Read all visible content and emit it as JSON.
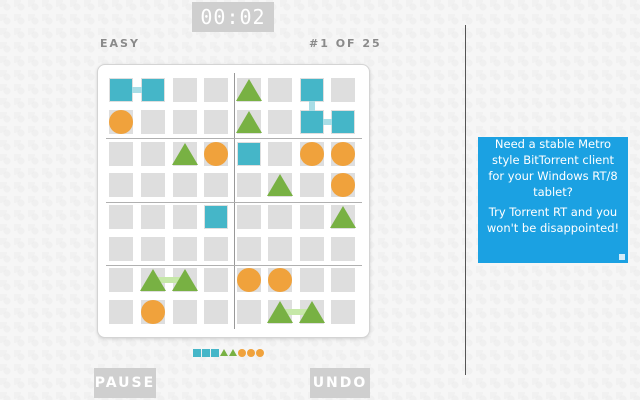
{
  "timer": "00:02",
  "difficulty": "EASY",
  "progress": "#1 OF 25",
  "colors": {
    "square": "#45b6c8",
    "circle": "#f0a23c",
    "triangle": "#78b143",
    "cell": "#dedede"
  },
  "board": {
    "size": 8,
    "pieces": [
      {
        "r": 0,
        "c": 0,
        "t": "square"
      },
      {
        "r": 0,
        "c": 1,
        "t": "square"
      },
      {
        "r": 0,
        "c": 4,
        "t": "triangle"
      },
      {
        "r": 0,
        "c": 6,
        "t": "square"
      },
      {
        "r": 1,
        "c": 0,
        "t": "circle"
      },
      {
        "r": 1,
        "c": 4,
        "t": "triangle"
      },
      {
        "r": 1,
        "c": 6,
        "t": "square"
      },
      {
        "r": 1,
        "c": 7,
        "t": "square"
      },
      {
        "r": 2,
        "c": 2,
        "t": "triangle"
      },
      {
        "r": 2,
        "c": 3,
        "t": "circle"
      },
      {
        "r": 2,
        "c": 4,
        "t": "square"
      },
      {
        "r": 2,
        "c": 6,
        "t": "circle"
      },
      {
        "r": 2,
        "c": 7,
        "t": "circle"
      },
      {
        "r": 3,
        "c": 5,
        "t": "triangle"
      },
      {
        "r": 3,
        "c": 7,
        "t": "circle"
      },
      {
        "r": 4,
        "c": 3,
        "t": "square"
      },
      {
        "r": 4,
        "c": 7,
        "t": "triangle"
      },
      {
        "r": 6,
        "c": 1,
        "t": "triangle"
      },
      {
        "r": 6,
        "c": 2,
        "t": "triangle"
      },
      {
        "r": 6,
        "c": 4,
        "t": "circle"
      },
      {
        "r": 6,
        "c": 5,
        "t": "circle"
      },
      {
        "r": 7,
        "c": 1,
        "t": "circle"
      },
      {
        "r": 7,
        "c": 5,
        "t": "triangle"
      },
      {
        "r": 7,
        "c": 6,
        "t": "triangle"
      }
    ],
    "connections": [
      {
        "from": [
          0,
          0
        ],
        "to": [
          0,
          1
        ],
        "t": "square"
      },
      {
        "from": [
          0,
          6
        ],
        "to": [
          1,
          6
        ],
        "t": "square"
      },
      {
        "from": [
          1,
          6
        ],
        "to": [
          1,
          7
        ],
        "t": "square"
      },
      {
        "from": [
          6,
          1
        ],
        "to": [
          6,
          2
        ],
        "t": "triangle"
      },
      {
        "from": [
          7,
          5
        ],
        "to": [
          7,
          6
        ],
        "t": "triangle"
      }
    ]
  },
  "legend": [
    "square",
    "square",
    "square",
    "triangle",
    "triangle",
    "circle",
    "circle",
    "circle"
  ],
  "buttons": {
    "pause": "PAUSE",
    "undo": "UNDO"
  },
  "ad": {
    "line1": "Need a stable Metro style BitTorrent client for your Windows RT/8 tablet?",
    "line2": "Try Torrent RT and you won't be disappointed!"
  }
}
